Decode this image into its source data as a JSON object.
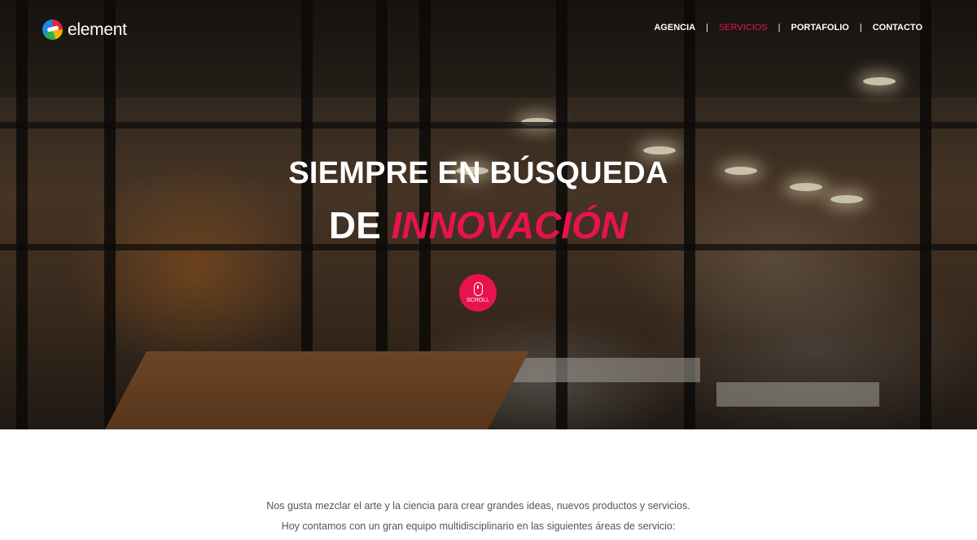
{
  "brand": {
    "name": "element",
    "logo_icon": "element-logo-icon"
  },
  "nav": {
    "items": [
      {
        "label": "AGENCIA",
        "active": false
      },
      {
        "label": "SERVICIOS",
        "active": true
      },
      {
        "label": "PORTAFOLIO",
        "active": false
      },
      {
        "label": "CONTACTO",
        "active": false
      }
    ],
    "separator": "|"
  },
  "hero": {
    "headline_line1": "SIEMPRE EN BÚSQUEDA",
    "headline_line2_prefix": "DE",
    "headline_line2_accent": "INNOVACIÓN",
    "scroll_label": "SCROLL",
    "scroll_icon": "mouse-icon"
  },
  "intro": {
    "line1": "Nos gusta mezclar el arte y la ciencia para crear grandes ideas, nuevos productos y servicios.",
    "line2": "Hoy contamos con un gran equipo multidisciplinario en las siguientes áreas de servicio:"
  },
  "colors": {
    "accent": "#e8134d",
    "text_muted": "#555555"
  }
}
